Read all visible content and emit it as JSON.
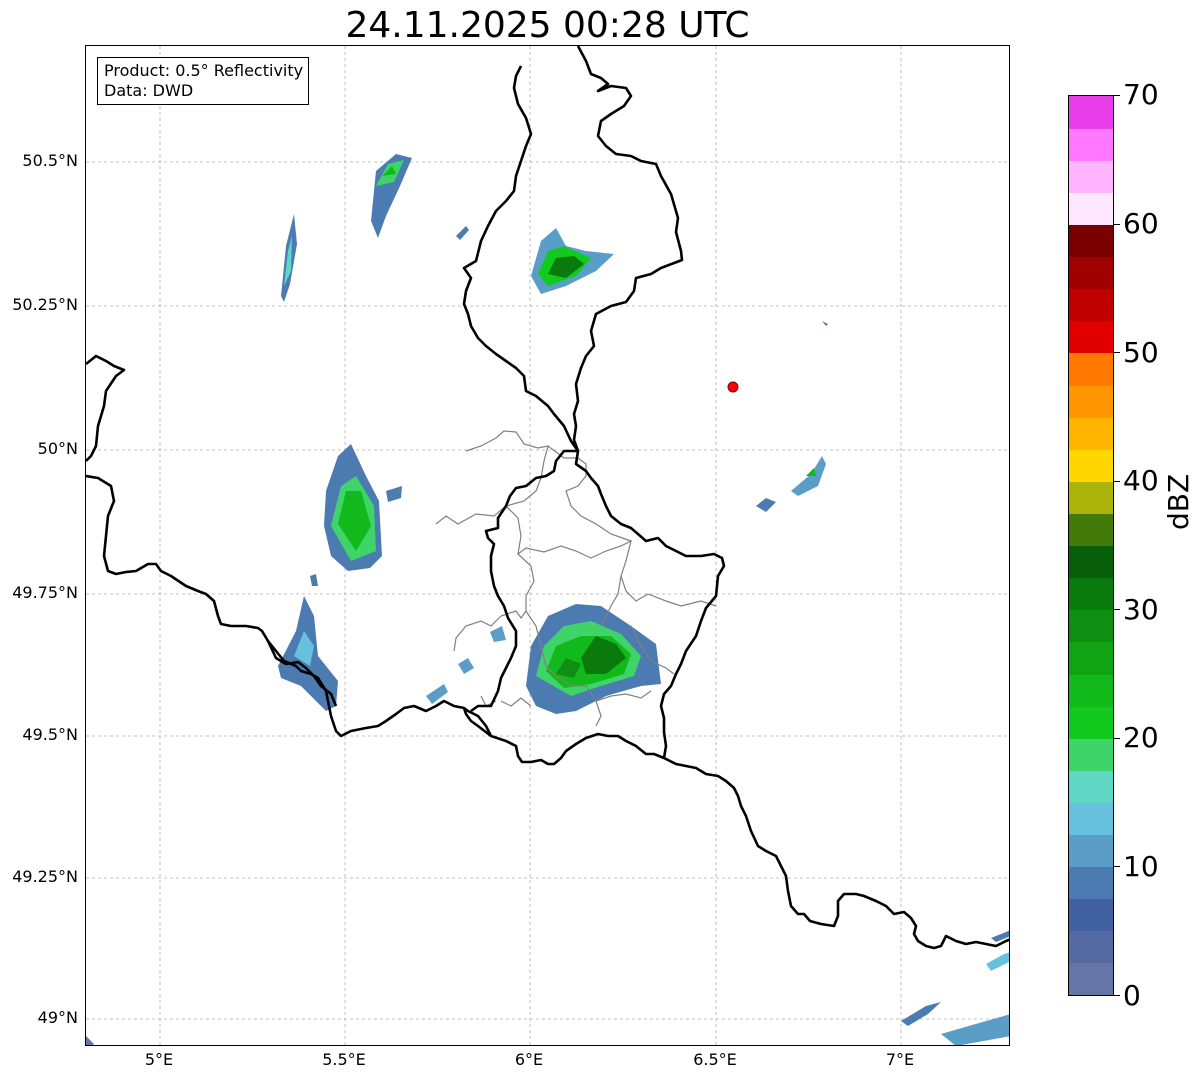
{
  "title": "24.11.2025 00:28 UTC",
  "infobox": {
    "line1": "Product: 0.5° Reflectivity",
    "line2": "Data: DWD"
  },
  "axes": {
    "lat_ticks": [
      "50.5°N",
      "50.25°N",
      "50°N",
      "49.75°N",
      "49.5°N",
      "49.25°N",
      "49°N"
    ],
    "lon_ticks": [
      "5°E",
      "5.5°E",
      "6°E",
      "6.5°E",
      "7°E"
    ],
    "grid": true
  },
  "colorbar": {
    "label": "dBZ",
    "ticks": [
      "0",
      "10",
      "20",
      "30",
      "40",
      "50",
      "60",
      "70"
    ],
    "colors": [
      "#6675a8",
      "#536ba0",
      "#4261a3",
      "#4c7bb1",
      "#5a9ec8",
      "#66c2dc",
      "#60d6c4",
      "#3ed46a",
      "#12c91e",
      "#12b91a",
      "#10a414",
      "#0e8e12",
      "#0a7a0e",
      "#075e0b",
      "#447a0a",
      "#aab40a",
      "#ffd700",
      "#ffb400",
      "#ff9600",
      "#ff7800",
      "#e00000",
      "#c00000",
      "#a00000",
      "#7a0000",
      "#ffe6ff",
      "#ffb4ff",
      "#ff78ff",
      "#e83ce8"
    ]
  },
  "colors": {
    "border": "#000000",
    "district_border": "#808080",
    "radar_site": "#ff0000"
  }
}
